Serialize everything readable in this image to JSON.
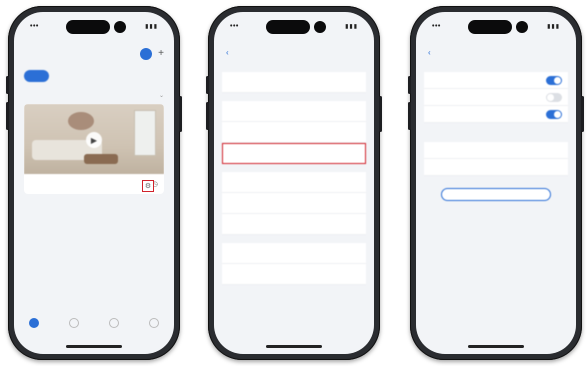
{
  "colors": {
    "accent": "#2b6fd6",
    "highlight": "#d1222b",
    "danger": "#e05a4f",
    "screen_bg": "#f2f4f7"
  },
  "phone1": {
    "home_title": "",
    "tabs": [
      {
        "label": ""
      },
      {
        "label": ""
      },
      {
        "label": ""
      }
    ],
    "active_tab": 0,
    "section_label": "",
    "camera_name": "",
    "highlighted_control": "gear-icon",
    "tab_bar": [
      {
        "label": ""
      },
      {
        "label": ""
      },
      {
        "label": ""
      },
      {
        "label": ""
      }
    ]
  },
  "phone2": {
    "nav_title": "",
    "subtitle": "",
    "menu_items": [
      {
        "label": ""
      },
      {
        "label": ""
      },
      {
        "label": ""
      },
      {
        "label": "",
        "highlighted": true
      },
      {
        "label": ""
      },
      {
        "label": ""
      },
      {
        "label": ""
      },
      {
        "label": ""
      },
      {
        "label": ""
      }
    ],
    "danger_actions": [
      {
        "label": ""
      },
      {
        "label": ""
      }
    ]
  },
  "phone3": {
    "nav_title": "",
    "toggle_group_label": "",
    "toggles": [
      {
        "label": "",
        "on": true
      },
      {
        "label": "",
        "on": false
      },
      {
        "label": "",
        "on": true
      }
    ],
    "value_group_label": "",
    "value_rows": [
      {
        "label": "",
        "value": ""
      },
      {
        "label": "",
        "value": ""
      }
    ],
    "note": "",
    "button_label": ""
  }
}
